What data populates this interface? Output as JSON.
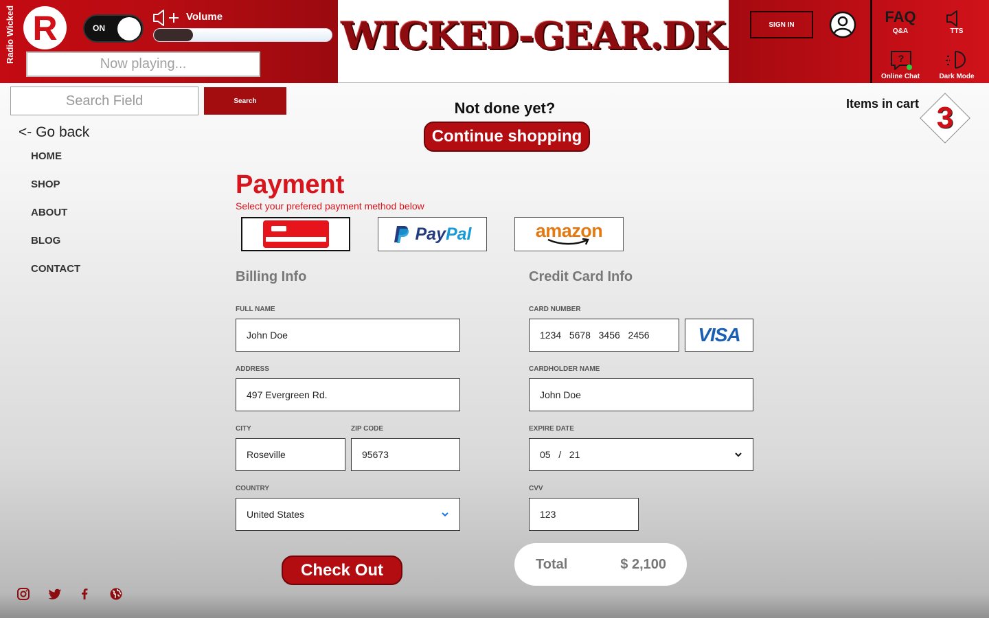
{
  "header": {
    "radio_label": "Radio Wicked",
    "logo_letter": "R",
    "toggle_label": "ON",
    "volume_label": "Volume",
    "volume_level": 0.22,
    "now_playing": "Now playing...",
    "brand": "WICKED-GEAR.DK",
    "sign_in": "SIGN IN",
    "faq_big": "FAQ",
    "faq_caption": "Q&A",
    "tts_caption": "TTS",
    "chat_caption": "Online Chat",
    "dark_mode_caption": "Dark Mode"
  },
  "search": {
    "placeholder": "Search Field",
    "button": "Search"
  },
  "nav": {
    "go_back": "<- Go back",
    "items": [
      {
        "label": "HOME"
      },
      {
        "label": "SHOP"
      },
      {
        "label": "ABOUT"
      },
      {
        "label": "BLOG"
      },
      {
        "label": "CONTACT"
      }
    ]
  },
  "cart": {
    "not_done": "Not done yet?",
    "continue": "Continue shopping",
    "items_label": "Items in cart",
    "count": "3"
  },
  "payment": {
    "title": "Payment",
    "subtitle": "Select your prefered payment method below",
    "methods": [
      {
        "name": "card",
        "icon": "credit-card-icon",
        "selected": true
      },
      {
        "name": "PayPal",
        "text_a": "Pay",
        "text_b": "Pal"
      },
      {
        "name": "amazon",
        "text": "amazon"
      }
    ]
  },
  "billing": {
    "title": "Billing Info",
    "full_name_label": "FULL NAME",
    "full_name": "John Doe",
    "address_label": "ADDRESS",
    "address": "497 Evergreen Rd.",
    "city_label": "CITY",
    "city": "Roseville",
    "zip_label": "ZIP CODE",
    "zip": "95673",
    "country_label": "COUNTRY",
    "country": "United States"
  },
  "card": {
    "title": "Credit Card Info",
    "number_label": "CARD NUMBER",
    "number": "1234   5678   3456   2456",
    "brand": "VISA",
    "holder_label": "CARDHOLDER NAME",
    "holder": "John Doe",
    "expire_label": "EXPIRE DATE",
    "expire": "05   /   21",
    "cvv_label": "CVV",
    "cvv": "123"
  },
  "checkout": {
    "button": "Check Out",
    "total_label": "Total",
    "total_value": "$ 2,100"
  },
  "social": [
    "instagram-icon",
    "twitter-icon",
    "facebook-icon",
    "globe-icon"
  ],
  "colors": {
    "brand_red": "#b30d12",
    "accent_red": "#d8141c",
    "online_green": "#2ecc40"
  }
}
